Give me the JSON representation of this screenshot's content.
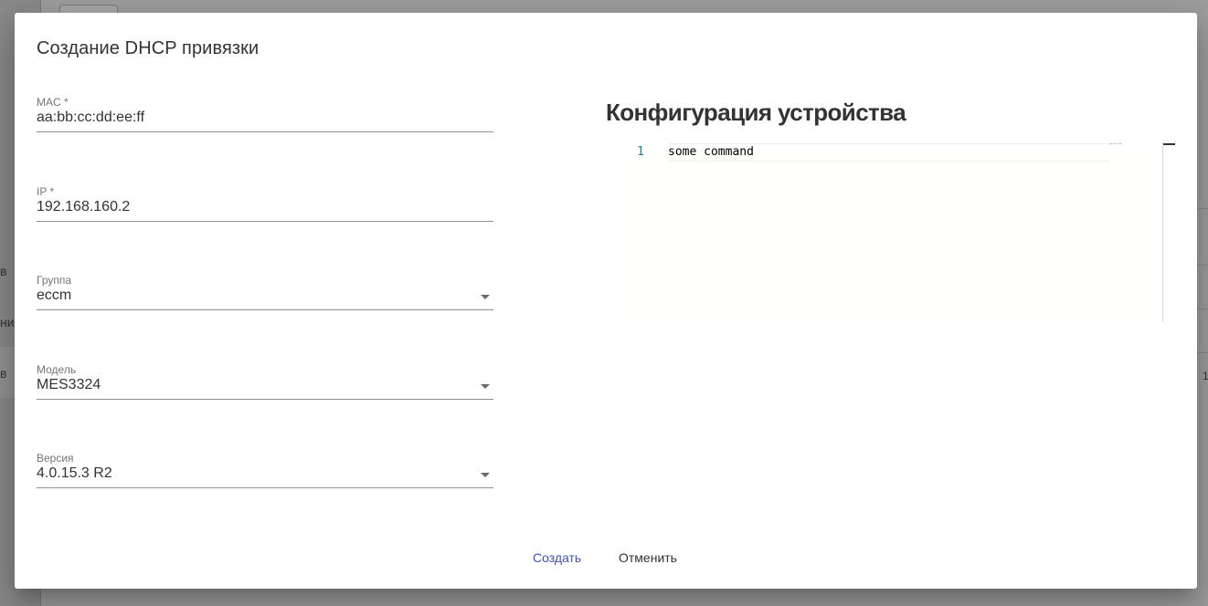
{
  "background": {
    "fragments": [
      "в",
      "ни",
      "в",
      "1"
    ]
  },
  "dialog": {
    "title": "Создание DHCP привязки",
    "fields": {
      "mac": {
        "label": "MAC *",
        "value": "aa:bb:cc:dd:ee:ff"
      },
      "ip": {
        "label": "IP *",
        "value": "192.168.160.2"
      },
      "group": {
        "label": "Группа",
        "value": "eccm"
      },
      "model": {
        "label": "Модель",
        "value": "MES3324"
      },
      "version": {
        "label": "Версия",
        "value": "4.0.15.3 R2"
      }
    },
    "config": {
      "title": "Конфигурация устройства",
      "line_number": "1",
      "code": "some command"
    },
    "actions": {
      "create_label": "Создать",
      "cancel_label": "Отменить"
    }
  },
  "colors": {
    "accent": "#3f51b5",
    "text": "#333333",
    "label": "#757575",
    "line_number": "#237893"
  },
  "icons": {
    "select_arrow": "chevron-down-icon"
  }
}
